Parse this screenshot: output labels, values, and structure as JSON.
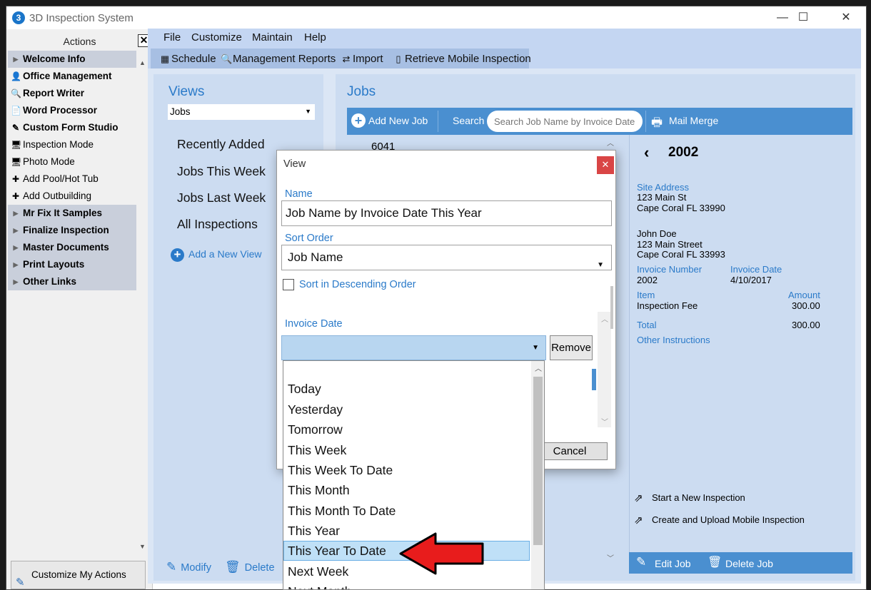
{
  "window": {
    "title": "3D Inspection System",
    "minimize": "—",
    "maximize": "☐",
    "close": "✕"
  },
  "actions": {
    "header": "Actions",
    "close": "✕",
    "items": [
      {
        "label": "Welcome Info",
        "icon": "▶",
        "kind": "group"
      },
      {
        "label": "Office Management",
        "icon": "👤",
        "kind": "bold"
      },
      {
        "label": "Report Writer",
        "icon": "🔍",
        "kind": "bold"
      },
      {
        "label": "Word Processor",
        "icon": "📄",
        "kind": "bold"
      },
      {
        "label": "Custom Form Studio",
        "icon": "✎",
        "kind": "bold"
      },
      {
        "label": "Inspection Mode",
        "icon": "🖥",
        "kind": "plain"
      },
      {
        "label": "Photo Mode",
        "icon": "🖥",
        "kind": "plain"
      },
      {
        "label": "Add Pool/Hot Tub",
        "icon": "✚",
        "kind": "plain"
      },
      {
        "label": "Add Outbuilding",
        "icon": "✚",
        "kind": "plain"
      },
      {
        "label": "Mr Fix It Samples",
        "icon": "▶",
        "kind": "group"
      },
      {
        "label": "Finalize Inspection",
        "icon": "▶",
        "kind": "group"
      },
      {
        "label": "Master Documents",
        "icon": "▶",
        "kind": "group"
      },
      {
        "label": "Print Layouts",
        "icon": "▶",
        "kind": "group"
      },
      {
        "label": "Other Links",
        "icon": "▶",
        "kind": "group"
      }
    ],
    "customize": "Customize My Actions"
  },
  "menu": {
    "file": "File",
    "customize": "Customize",
    "maintain": "Maintain",
    "help": "Help"
  },
  "toolbar": {
    "schedule": "Schedule",
    "management_reports": "Management Reports",
    "import": "Import",
    "retrieve": "Retrieve Mobile Inspection"
  },
  "views": {
    "title": "Views",
    "select": "Jobs",
    "items": [
      "Recently Added",
      "Jobs This Week",
      "Jobs Last Week",
      "All Inspections"
    ],
    "add": "Add a New View",
    "modify": "Modify",
    "delete": "Delete"
  },
  "jobs": {
    "title": "Jobs",
    "add": "Add New Job",
    "search_label": "Search",
    "search_placeholder": "Search Job Name by Invoice Date",
    "mail_merge": "Mail Merge",
    "first_row": "6041",
    "detail": {
      "number": "2002",
      "site_label": "Site Address",
      "site_line1": "123 Main St",
      "site_line2": "Cape Coral FL 33990",
      "client_name": "John Doe",
      "client_line1": "123 Main Street",
      "client_line2": "Cape Coral FL  33993",
      "invoice_number_label": "Invoice Number",
      "invoice_number": "2002",
      "invoice_date_label": "Invoice Date",
      "invoice_date": "4/10/2017",
      "item_label": "Item",
      "amount_label": "Amount",
      "item": "Inspection Fee",
      "amount": "300.00",
      "total_label": "Total",
      "total": "300.00",
      "other_instructions": "Other Instructions",
      "start_inspection": "Start a New Inspection",
      "create_upload": "Create and Upload Mobile Inspection",
      "edit": "Edit Job",
      "delete": "Delete Job"
    }
  },
  "dialog": {
    "title": "View",
    "close": "✕",
    "name_label": "Name",
    "name_value": "Job Name by Invoice Date This Year",
    "sort_label": "Sort Order",
    "sort_value": "Job Name",
    "descending": "Sort in Descending Order",
    "filter_label": "Invoice Date",
    "filter_value": "",
    "remove": "Remove",
    "cancel": "Cancel"
  },
  "dropdown": {
    "options": [
      "",
      "Today",
      "Yesterday",
      "Tomorrow",
      "This Week",
      "This Week To Date",
      "This Month",
      "This Month To Date",
      "This Year",
      "This Year To Date",
      "Next Week",
      "Next Month"
    ],
    "selected": "This Year To Date"
  },
  "colors": {
    "accent": "#2a7ac9",
    "bar": "#4a8fd0",
    "arrow": "#e81c1c",
    "close": "#d94545"
  }
}
